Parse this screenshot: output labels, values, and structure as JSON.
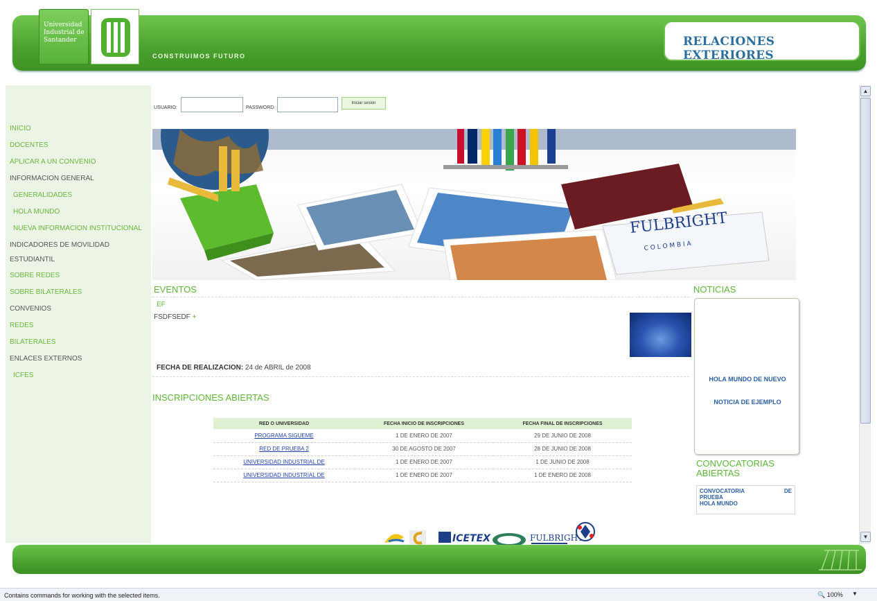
{
  "header": {
    "university_name_lines": [
      "Universidad",
      "Industrial de",
      "Santander"
    ],
    "slogan": "CONSTRUIMOS FUTURO",
    "site_title": "RELACIONES EXTERIORES"
  },
  "sidebar": {
    "items": [
      {
        "label": "INICIO"
      },
      {
        "label": "DOCENTES"
      },
      {
        "label": "APLICAR A UN CONVENIO"
      },
      {
        "label": "INFORMACION GENERAL"
      },
      {
        "label": "GENERALIDADES"
      },
      {
        "label": "HOLA MUNDO"
      },
      {
        "label": "NUEVA INFORMACION INSTITUCIONAL"
      },
      {
        "label": "INDICADORES DE MOVILIDAD"
      },
      {
        "label": "ESTUDIANTIL"
      },
      {
        "label": "SOBRE REDES"
      },
      {
        "label": "SOBRE BILATERALES"
      },
      {
        "label": "CONVENIOS"
      },
      {
        "label": "REDES"
      },
      {
        "label": "BILATERALES"
      },
      {
        "label": "ENLACES EXTERNOS"
      },
      {
        "label": "ICFES"
      }
    ]
  },
  "login": {
    "usuario_label": "USUARIO:",
    "password_label": "PASSWORD:",
    "button_label": "Iniciar sesion"
  },
  "eventos": {
    "title": "EVENTOS",
    "code": "EF",
    "name": "FSDFSEDF",
    "more": "+",
    "date_label": "FECHA DE REALIZACION:",
    "date_value": "24 de ABRIL de 2008"
  },
  "inscripciones": {
    "title": "INSCRIPCIONES ABIERTAS",
    "columns": [
      "RED O UNIVERSIDAD",
      "FECHA INICIO DE INSCRIPCIONES",
      "FECHA FINAL DE INSCRIPCIONES"
    ],
    "rows": [
      [
        "PROGRAMA SIGUEME",
        "1 DE ENERO DE 2007",
        "29 DE JUNIO DE 2008"
      ],
      [
        "RED DE PRUEBA 2",
        "30 DE AGOSTO DE 2007",
        "28 DE JUNIO DE 2008"
      ],
      [
        "UNIVERSIDAD INDUSTRIAL DE",
        "1 DE ENERO DE 2007",
        "1 DE JUNIO DE 2008"
      ],
      [
        "UNIVERSIDAD INDUSTRIAL DE",
        "1 DE ENERO DE 2007",
        "1 DE ENERO DE 2008"
      ]
    ]
  },
  "noticias": {
    "title": "NOTICIAS",
    "items": [
      "HOLA MUNDO DE NUEVO",
      "NOTICIA DE EJEMPLO"
    ]
  },
  "convocatorias": {
    "title": "CONVOCATORIAS ABIERTAS",
    "item1_a": "CONVOCATORIA",
    "item1_b": "DE",
    "item1_c": "PRUEBA",
    "item2": "HOLA MUNDO"
  },
  "banner": {
    "fulbright_text": "FULBRIGHT",
    "colombia_text": "C O L O M B I A"
  },
  "partners": {
    "fulbright": "FULBRIGHT",
    "icetex": "ICETEX"
  },
  "statusbar": {
    "text": "Contains commands for working with the selected items.",
    "zoom": "100%"
  },
  "colors": {
    "brand_green": "#4aa12e",
    "link_blue": "#2344a8",
    "title_blue": "#2c6f9c",
    "nav_green": "#67b93c"
  }
}
